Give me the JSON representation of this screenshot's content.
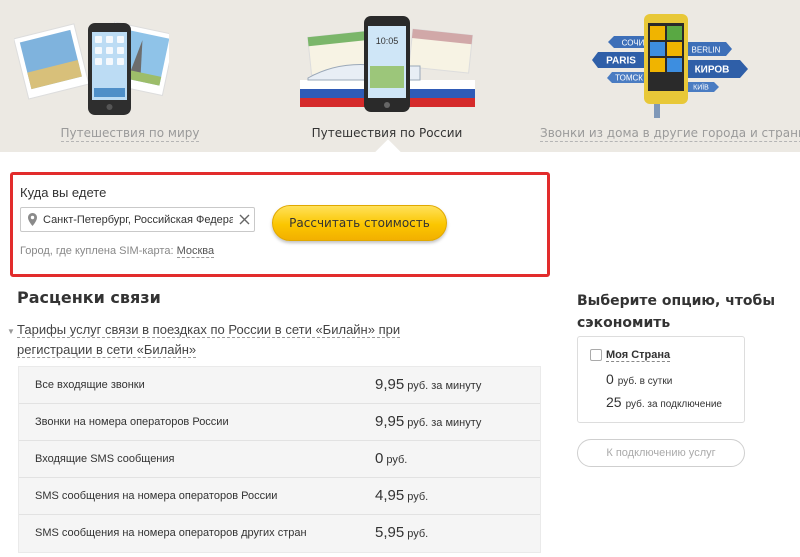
{
  "tabs": [
    {
      "label": "Путешествия по миру",
      "active": false,
      "icon": "world-travel-phone-photos-illustration"
    },
    {
      "label": "Путешествия по России",
      "active": true,
      "icon": "russia-travel-phone-train-illustration"
    },
    {
      "label": "Звонки из дома в другие города и страны",
      "active": false,
      "icon": "city-signposts-phone-illustration"
    }
  ],
  "phone_clock": "10:05",
  "signposts": {
    "sochi": "СОЧИ",
    "paris": "PARIS",
    "tomsk": "ТОМСК",
    "berlin": "BERLIN",
    "kirov": "КИРОВ",
    "kyiv": "КИЇВ"
  },
  "destination_form": {
    "title": "Куда вы едете",
    "input_value": "Санкт-Петербург, Российская Федерация",
    "calculate_label": "Рассчитать стоимость",
    "sim_label": "Город, где куплена SIM-карта:",
    "sim_city": "Москва"
  },
  "rates": {
    "title": "Расценки связи",
    "description": "Тарифы услуг связи в поездках по России в сети «Билайн» при регистрации в сети «Билайн»",
    "rows": [
      {
        "name": "Все входящие звонки",
        "price": "9,95",
        "unit": "руб. за минуту"
      },
      {
        "name": "Звонки на номера операторов России",
        "price": "9,95",
        "unit": "руб. за минуту"
      },
      {
        "name": "Входящие SMS сообщения",
        "price": "0",
        "unit": "руб."
      },
      {
        "name": "SMS сообщения на номера операторов России",
        "price": "4,95",
        "unit": "руб."
      },
      {
        "name": "SMS сообщения на номера операторов других стран",
        "price": "5,95",
        "unit": "руб."
      }
    ]
  },
  "options": {
    "title": "Выберите опцию, чтобы сэкономить",
    "option_name": "Моя Страна",
    "daily_value": "0",
    "daily_unit": "руб. в сутки",
    "connect_value": "25",
    "connect_unit": "руб. за подключение",
    "connect_button": "К подключению услуг"
  },
  "colors": {
    "accent_yellow": "#fbc600",
    "highlight_red": "#e22c2c",
    "top_bg": "#ece9e3"
  }
}
